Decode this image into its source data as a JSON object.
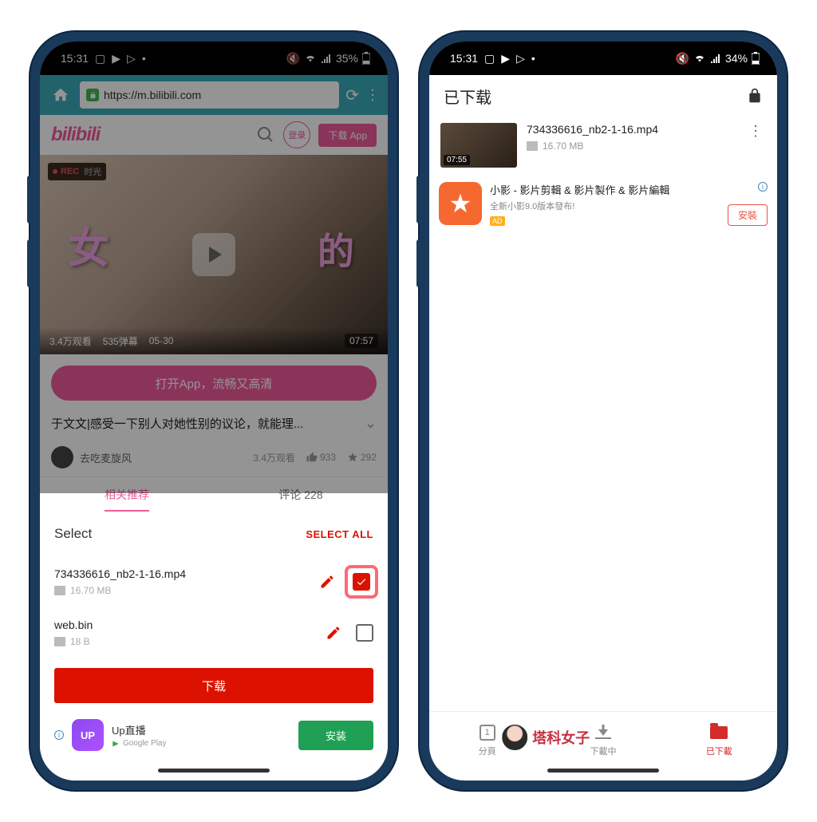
{
  "phone1": {
    "status": {
      "time": "15:31",
      "battery": "35%"
    },
    "browser": {
      "url": "https://m.bilibili.com"
    },
    "site": {
      "login": "登录",
      "download_app": "下载 App"
    },
    "video": {
      "rec": "REC",
      "views": "3.4万观看",
      "danmu": "535弹幕",
      "date": "05-30",
      "duration": "07:57",
      "char_left": "女",
      "char_right": "的"
    },
    "open_app": "打开App，流畅又高清",
    "title": "于文文|感受一下别人对她性别的议论，就能理...",
    "uploader": {
      "name": "去吃麦旋风",
      "views": "3.4万观看",
      "likes": "933",
      "favs": "292"
    },
    "tabs": {
      "related": "相关推荐",
      "comments": "评论 228"
    },
    "sheet": {
      "title": "Select",
      "select_all": "SELECT ALL",
      "items": [
        {
          "name": "734336616_nb2-1-16.mp4",
          "size": "16.70 MB"
        },
        {
          "name": "web.bin",
          "size": "18 B"
        }
      ],
      "download": "下载"
    },
    "ad": {
      "title": "Up直播",
      "sub": "Google Play",
      "install": "安装",
      "logo": "UP"
    }
  },
  "phone2": {
    "status": {
      "time": "15:31",
      "battery": "34%"
    },
    "header": "已下载",
    "file": {
      "name": "734336616_nb2-1-16.mp4",
      "size": "16.70 MB",
      "duration": "07:55"
    },
    "ad": {
      "title": "小影 - 影片剪輯 & 影片製作 & 影片編輯",
      "sub": "全新小影9.0版本發布!",
      "badge": "AD",
      "install": "安裝"
    },
    "nav": {
      "pages": "分頁",
      "page_num": "1",
      "downloading": "下載中",
      "downloaded": "已下載"
    }
  },
  "watermark": "塔科女子"
}
